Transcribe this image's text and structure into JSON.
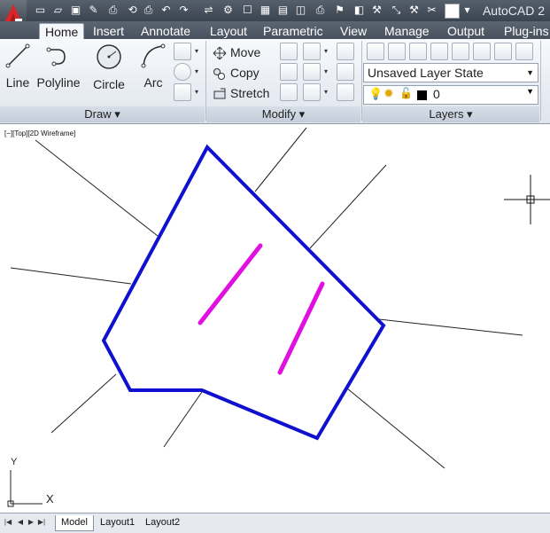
{
  "window": {
    "title": "AutoCAD 2"
  },
  "qat": {
    "items": [
      "new-icon",
      "open-icon",
      "save-icon",
      "save-as-icon",
      "plot-icon",
      "undo-icon",
      "redo-icon",
      "match-properties-icon",
      "properties-icon",
      "quick-calc-icon",
      "layer-icon",
      "print-icon",
      "clean-screen-icon",
      "workspace-icon",
      "options-icon",
      "measure-icon",
      "tool-icon",
      "color-swatch-icon",
      "customize-icon"
    ]
  },
  "tabs": [
    {
      "label": "Home",
      "active": true
    },
    {
      "label": "Insert"
    },
    {
      "label": "Annotate"
    },
    {
      "label": "Layout"
    },
    {
      "label": "Parametric"
    },
    {
      "label": "View"
    },
    {
      "label": "Manage"
    },
    {
      "label": "Output"
    },
    {
      "label": "Plug-ins"
    }
  ],
  "draw_panel": {
    "title": "Draw ▾",
    "tools": [
      "Line",
      "Polyline",
      "Circle",
      "Arc"
    ]
  },
  "modify_panel": {
    "title": "Modify ▾",
    "tools": [
      "Move",
      "Copy",
      "Stretch"
    ]
  },
  "layers_panel": {
    "title": "Layers ▾",
    "layer_state": "Unsaved Layer State",
    "current_layer": "0"
  },
  "viewport": {
    "label": "[−][Top][2D Wireframe]",
    "ucs_y": "Y",
    "ucs_x": "X",
    "polyline_color": "#1010d0",
    "line_color": "#e010e0"
  },
  "layout_tabs": [
    "Model",
    "Layout1",
    "Layout2"
  ]
}
